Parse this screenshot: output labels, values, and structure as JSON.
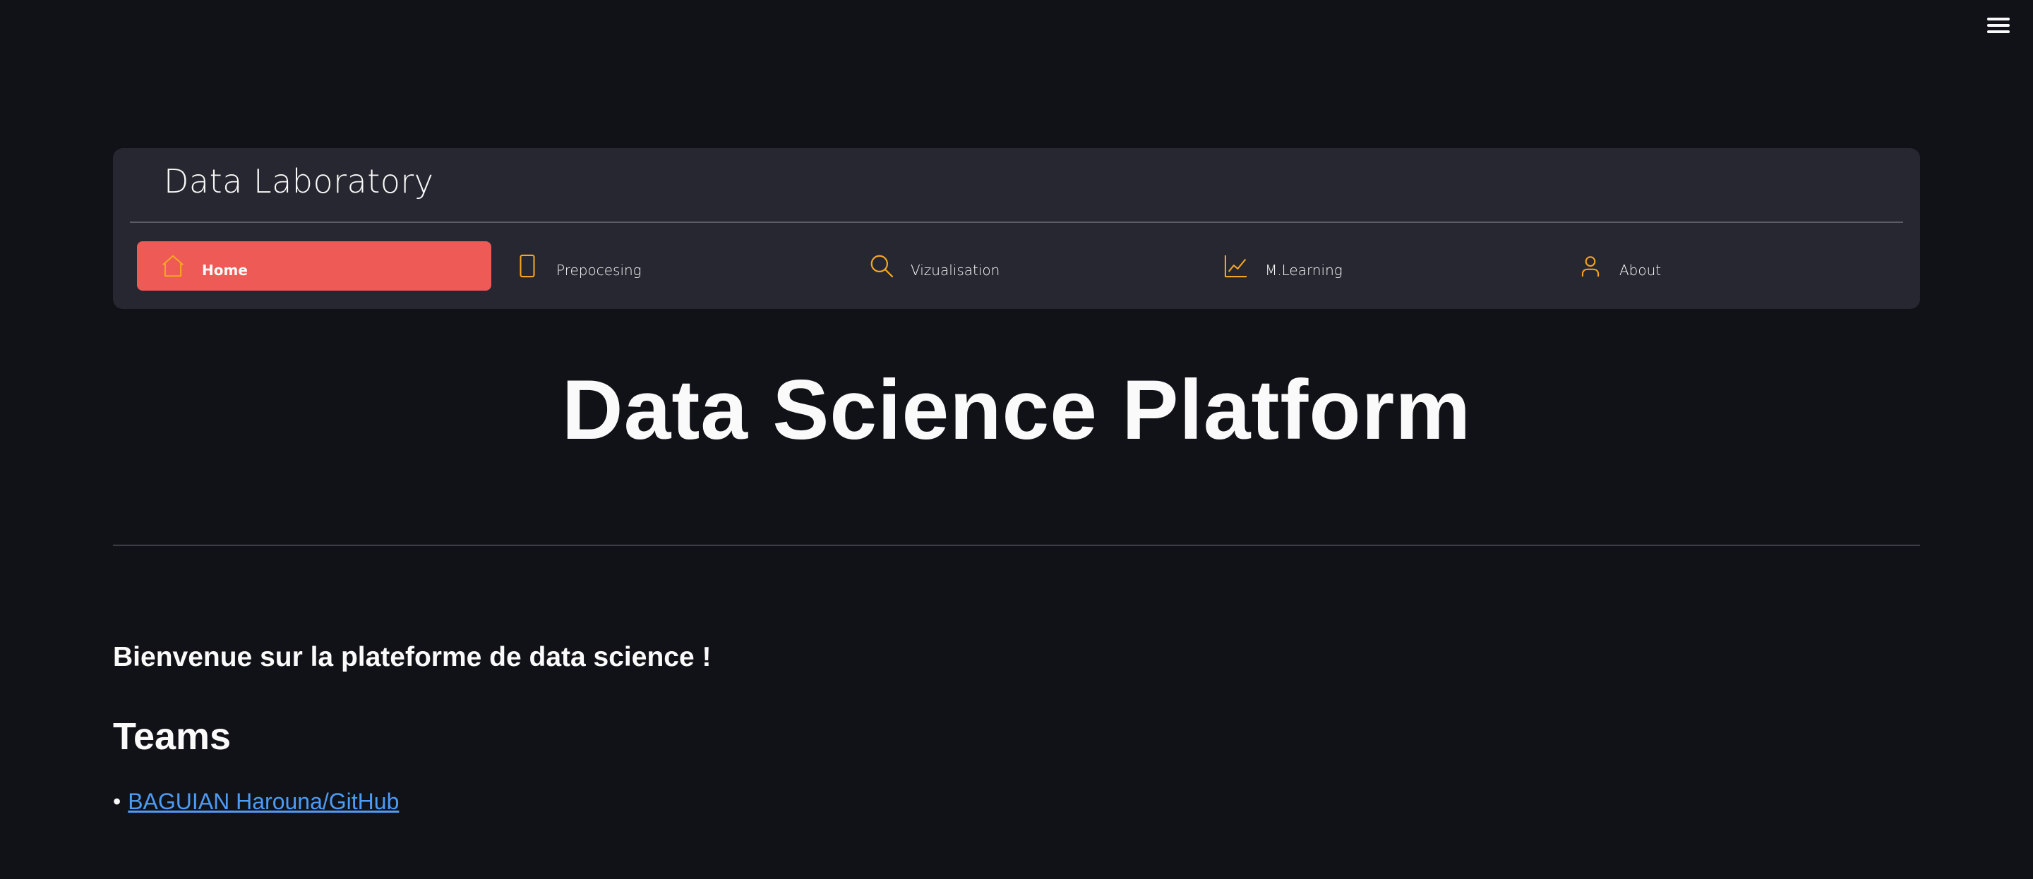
{
  "header": {
    "menu_icon": "hamburger-menu-icon"
  },
  "nav": {
    "title": "Data Laboratory",
    "accent_color": "#ee5a55",
    "icon_color": "#f5a623",
    "items": [
      {
        "label": "Home",
        "icon": "house-icon",
        "active": true
      },
      {
        "label": "Prepocesing",
        "icon": "tablet-icon",
        "active": false
      },
      {
        "label": "Vizualisation",
        "icon": "search-icon",
        "active": false
      },
      {
        "label": "M.Learning",
        "icon": "line-chart-icon",
        "active": false
      },
      {
        "label": "About",
        "icon": "person-icon",
        "active": false
      }
    ]
  },
  "main": {
    "title": "Data Science Platform",
    "welcome": "Bienvenue sur la plateforme de data science !",
    "teams_heading": "Teams",
    "members": [
      {
        "bullet": "•",
        "link_text": "BAGUIAN Harouna/GitHub"
      }
    ]
  }
}
